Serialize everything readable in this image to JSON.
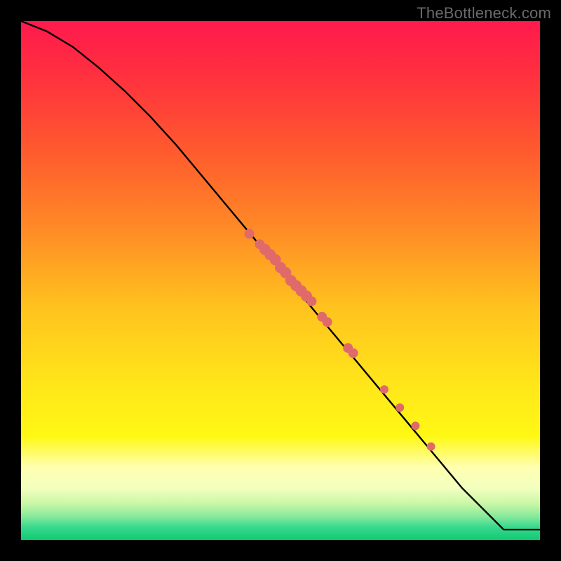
{
  "watermark": "TheBottleneck.com",
  "chart_data": {
    "type": "line",
    "title": "",
    "xlabel": "",
    "ylabel": "",
    "xlim": [
      0,
      100
    ],
    "ylim": [
      0,
      100
    ],
    "grid": false,
    "series": [
      {
        "name": "curve",
        "x": [
          0,
          5,
          10,
          15,
          20,
          25,
          30,
          35,
          40,
          45,
          50,
          55,
          60,
          65,
          70,
          75,
          80,
          85,
          90,
          93,
          100
        ],
        "y": [
          100,
          98,
          95,
          91,
          86.5,
          81.5,
          76,
          70,
          64,
          58,
          52,
          46,
          40,
          34,
          28,
          22,
          16,
          10,
          5,
          2,
          2
        ]
      }
    ],
    "markers": {
      "name": "highlighted-points",
      "color": "#e06a6a",
      "x": [
        44,
        46,
        47,
        48,
        49,
        50,
        51,
        52,
        53,
        54,
        55,
        56,
        58,
        59,
        63,
        64,
        70,
        73,
        76,
        79
      ],
      "y": [
        59,
        57,
        56,
        55,
        54,
        52.5,
        51.5,
        50,
        49,
        48,
        47,
        46,
        43,
        42,
        37,
        36,
        29,
        25.5,
        22,
        18
      ],
      "r": [
        7,
        7,
        8,
        8,
        8,
        8,
        8,
        8,
        8,
        8,
        8,
        7,
        7,
        7,
        7,
        7,
        6,
        6,
        6,
        6
      ]
    },
    "gradient_stops": [
      {
        "offset": 0,
        "color": "#ff1a4d"
      },
      {
        "offset": 0.1,
        "color": "#ff2f3f"
      },
      {
        "offset": 0.25,
        "color": "#ff5a2e"
      },
      {
        "offset": 0.4,
        "color": "#ff8a26"
      },
      {
        "offset": 0.55,
        "color": "#ffc21e"
      },
      {
        "offset": 0.7,
        "color": "#ffe61a"
      },
      {
        "offset": 0.8,
        "color": "#fff814"
      },
      {
        "offset": 0.86,
        "color": "#ffffb0"
      },
      {
        "offset": 0.9,
        "color": "#f3ffbf"
      },
      {
        "offset": 0.93,
        "color": "#caf7a7"
      },
      {
        "offset": 0.955,
        "color": "#86e99b"
      },
      {
        "offset": 0.975,
        "color": "#39d98e"
      },
      {
        "offset": 1.0,
        "color": "#10c971"
      }
    ]
  }
}
